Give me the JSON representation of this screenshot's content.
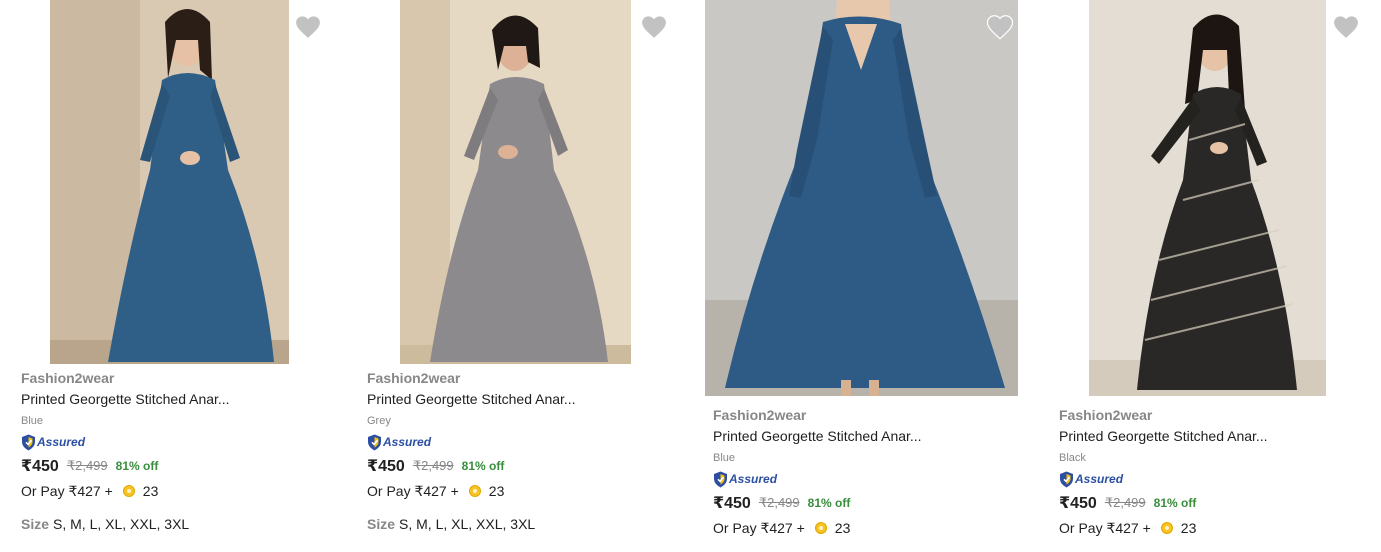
{
  "products": [
    {
      "brand": "Fashion2wear",
      "title": "Printed Georgette Stitched Anar...",
      "color": "Blue",
      "assured_label": "Assured",
      "price": "₹450",
      "mrp": "₹2,499",
      "discount": "81% off",
      "pay_text": "Or Pay ₹427 +",
      "coins": "23",
      "size_label": "Size",
      "sizes": "S, M, L, XL, XXL, 3XL",
      "dress_color": "#2f5f86",
      "wall_color": "#d9c9b3",
      "wishlist_icon": "heart-icon"
    },
    {
      "brand": "Fashion2wear",
      "title": "Printed Georgette Stitched Anar...",
      "color": "Grey",
      "assured_label": "Assured",
      "price": "₹450",
      "mrp": "₹2,499",
      "discount": "81% off",
      "pay_text": "Or Pay ₹427 +",
      "coins": "23",
      "size_label": "Size",
      "sizes": "S, M, L, XL, XXL, 3XL",
      "dress_color": "#8c8a8c",
      "wall_color": "#e6d9c4",
      "wishlist_icon": "heart-icon"
    },
    {
      "brand": "Fashion2wear",
      "title": "Printed Georgette Stitched Anar...",
      "color": "Blue",
      "assured_label": "Assured",
      "price": "₹450",
      "mrp": "₹2,499",
      "discount": "81% off",
      "pay_text": "Or Pay ₹427 +",
      "coins": "23",
      "dress_color": "#2d5b85",
      "wall_color": "#c9c8c4",
      "wishlist_icon": "heart-icon"
    },
    {
      "brand": "Fashion2wear",
      "title": "Printed Georgette Stitched Anar...",
      "color": "Black",
      "assured_label": "Assured",
      "price": "₹450",
      "mrp": "₹2,499",
      "discount": "81% off",
      "pay_text": "Or Pay ₹427 +",
      "coins": "23",
      "dress_color": "#2a2826",
      "wall_color": "#e3ddd3",
      "wishlist_icon": "heart-icon"
    }
  ],
  "colors": {
    "brand_text": "#878787",
    "discount_green": "#388e3c",
    "assured_blue": "#2c4fa3",
    "heart_grey": "#c2c2c2"
  }
}
